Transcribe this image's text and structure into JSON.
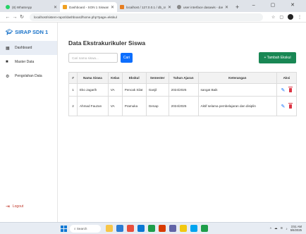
{
  "browser": {
    "tabs": [
      {
        "title": "(8) WhatsApp",
        "favicon_color": "#25d366",
        "active": false
      },
      {
        "title": "Dashboard - SON 1 Siswan",
        "favicon_color": "#f0a020",
        "active": true
      },
      {
        "title": "localhost / 127.0.0.1 / db_rapor",
        "favicon_color": "#e67e22",
        "active": false
      },
      {
        "title": "user interface dasawis - dasa st",
        "favicon_color": "#888888",
        "active": false
      }
    ],
    "new_tab": "+",
    "window_controls": "– ▢ ✕",
    "url": "localhost/sistem-rapot/dashboard/home.php?page=ekskul"
  },
  "sidebar": {
    "brand": "SIRAP SDN 1",
    "items": [
      {
        "label": "Dashboard",
        "icon": "dashboard-icon",
        "active": true
      },
      {
        "label": "Master Data",
        "icon": "folder-icon",
        "active": false
      },
      {
        "label": "Pengolahan Data",
        "icon": "sliders-icon",
        "active": false
      }
    ],
    "logout": "Logout"
  },
  "main": {
    "title": "Data Ekstrakurikuler Siswa",
    "search_placeholder": "Cari nama siswa...",
    "search_button": "Cari",
    "add_button": "+ Tambah Ekskul",
    "table": {
      "headers": [
        "#",
        "Nama Siswa",
        "Kelas",
        "Ekskul",
        "Semester",
        "Tahun Ajaran",
        "Keterangan",
        "Aksi"
      ],
      "rows": [
        [
          "1",
          "Eko Jagarih",
          "VA",
          "Pencak Silat",
          "Ganjil",
          "2024/2025",
          "sangat Baik"
        ],
        [
          "2",
          "Ahmad Fauzan",
          "VA",
          "Pramuka",
          "Genap",
          "2024/2025",
          "Aktif selama pembelajaran dan disiplin"
        ]
      ]
    }
  },
  "taskbar": {
    "search": "Search",
    "app_colors": [
      "#f7c548",
      "#2b7cd3",
      "#e94e3c",
      "#0a78d4",
      "#1e9e4a",
      "#d83b01",
      "#6264a7",
      "#f2c811",
      "#00a4ef",
      "#1e9e4a"
    ],
    "time": "3:51 AM",
    "date": "5/6/2025"
  },
  "colors": {
    "brand": "#1a73c9",
    "primary": "#0d6efd",
    "success": "#198754",
    "danger": "#dc3545"
  }
}
